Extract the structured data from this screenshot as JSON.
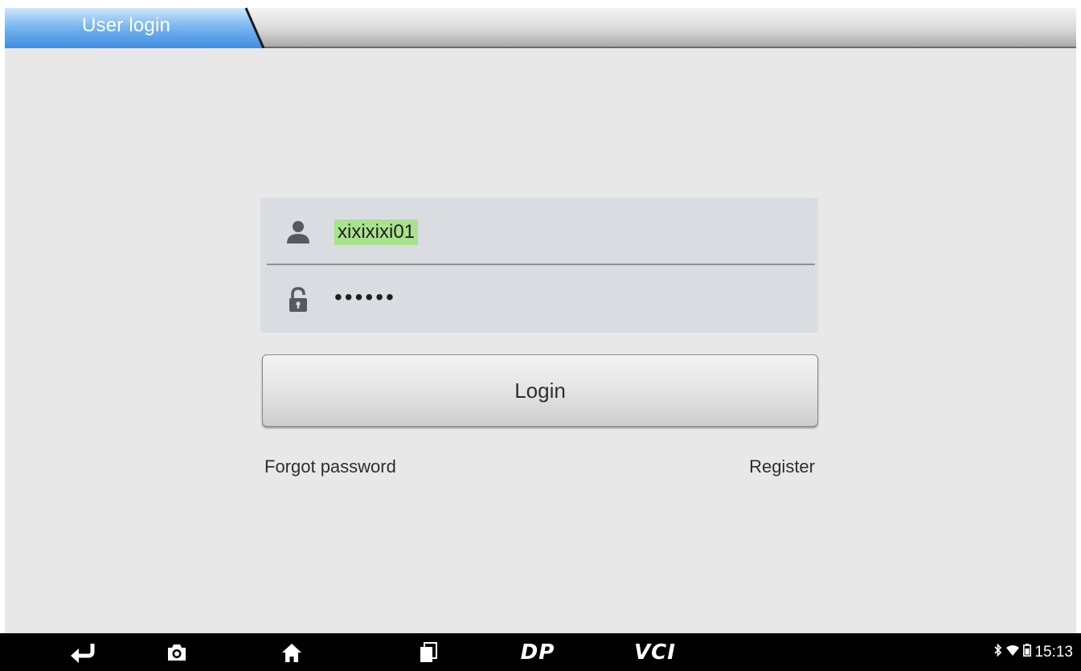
{
  "header": {
    "active_tab": "User login"
  },
  "login_form": {
    "username_value": "xixixixi01",
    "password_masked": "••••••",
    "login_label": "Login",
    "forgot_label": "Forgot password",
    "register_label": "Register"
  },
  "navbar": {
    "dp_label": "DP",
    "vci_label": "VCI"
  },
  "status_bar": {
    "time": "15:13",
    "icons": [
      "bluetooth-icon",
      "wifi-icon",
      "battery-icon"
    ]
  },
  "colors": {
    "tab_accent": "#4f9ae3",
    "username_highlight": "#a9e28c",
    "navbar_bg": "#000000"
  }
}
